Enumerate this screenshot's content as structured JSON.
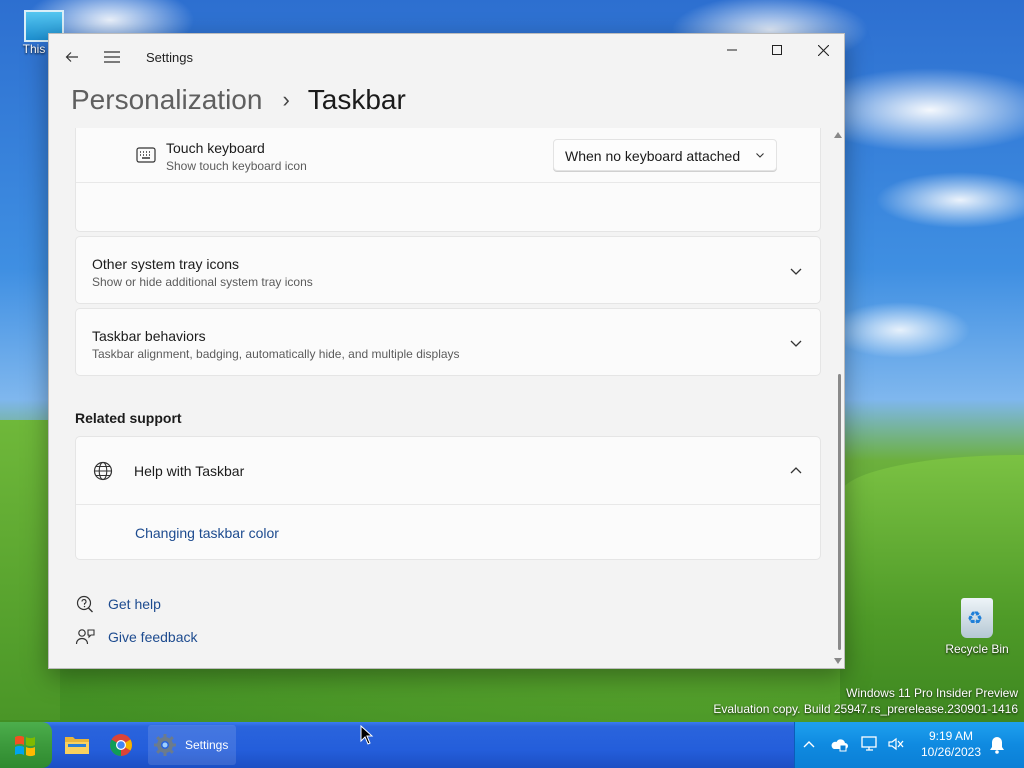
{
  "desktop": {
    "this_pc_label": "This PC",
    "recycle_bin_label": "Recycle Bin",
    "watermark_line1": "Windows 11 Pro Insider Preview",
    "watermark_line2": "Evaluation copy. Build 25947.rs_prerelease.230901-1416"
  },
  "window": {
    "app_title": "Settings",
    "breadcrumb_parent": "Personalization",
    "breadcrumb_separator": "›",
    "breadcrumb_current": "Taskbar"
  },
  "touch_keyboard": {
    "title": "Touch keyboard",
    "subtitle": "Show touch keyboard icon",
    "dropdown_value": "When no keyboard attached"
  },
  "other_tray": {
    "title": "Other system tray icons",
    "subtitle": "Show or hide additional system tray icons"
  },
  "behaviors": {
    "title": "Taskbar behaviors",
    "subtitle": "Taskbar alignment, badging, automatically hide, and multiple displays"
  },
  "related_support": {
    "heading": "Related support",
    "help_title": "Help with Taskbar",
    "link": "Changing taskbar color"
  },
  "footer_links": {
    "get_help": "Get help",
    "give_feedback": "Give feedback"
  },
  "taskbar": {
    "settings_label": "Settings",
    "time": "9:19 AM",
    "date": "10/26/2023"
  }
}
